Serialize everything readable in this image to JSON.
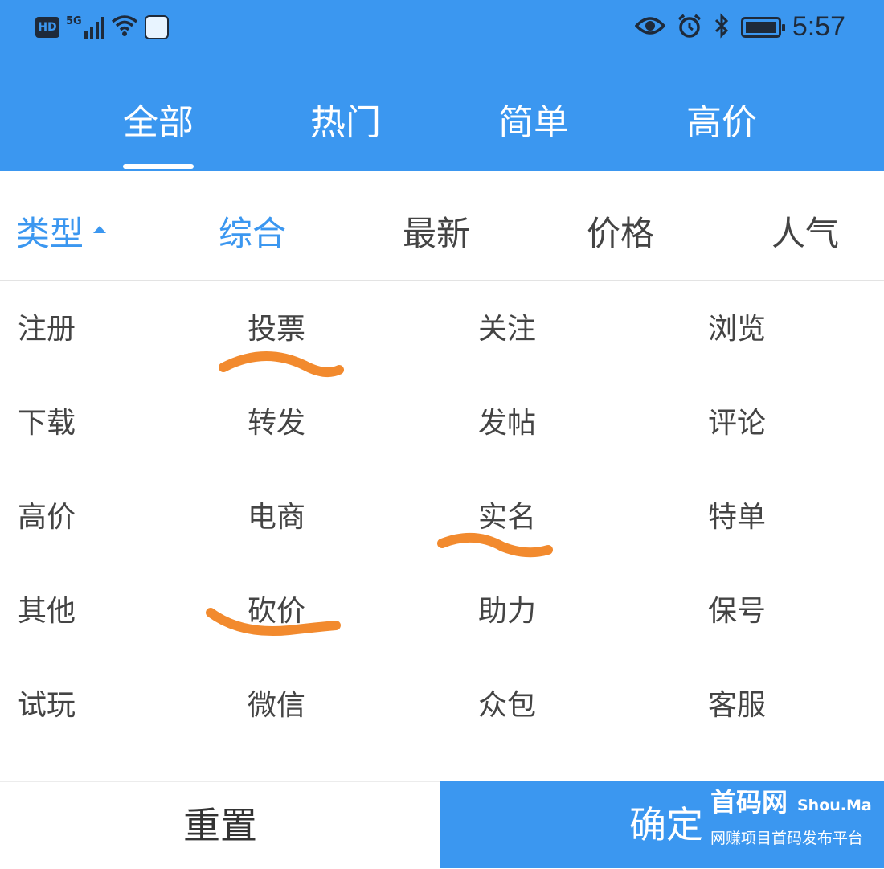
{
  "status_bar": {
    "left_badge": "HD",
    "signal_label": "5G",
    "time": "5:57"
  },
  "top_tabs": [
    {
      "label": "全部",
      "active": true
    },
    {
      "label": "热门",
      "active": false
    },
    {
      "label": "简单",
      "active": false
    },
    {
      "label": "高价",
      "active": false
    }
  ],
  "sort_bar": {
    "type_label": "类型",
    "items": [
      {
        "label": "综合",
        "active": true
      },
      {
        "label": "最新",
        "active": false
      },
      {
        "label": "价格",
        "active": false
      },
      {
        "label": "人气",
        "active": false
      }
    ]
  },
  "categories": [
    [
      "注册",
      "投票",
      "关注",
      "浏览"
    ],
    [
      "下载",
      "转发",
      "发帖",
      "评论"
    ],
    [
      "高价",
      "电商",
      "实名",
      "特单"
    ],
    [
      "其他",
      "砍价",
      "助力",
      "保号"
    ],
    [
      "试玩",
      "微信",
      "众包",
      "客服"
    ]
  ],
  "highlighted": [
    "投票",
    "实名",
    "砍价"
  ],
  "highlight_color": "#f28a2e",
  "accent_color": "#3b97f0",
  "buttons": {
    "reset": "重置",
    "confirm": "确定"
  },
  "watermark": {
    "title": "首码网",
    "brand": "Shou.Ma",
    "subtitle": "网赚项目首码发布平台"
  }
}
